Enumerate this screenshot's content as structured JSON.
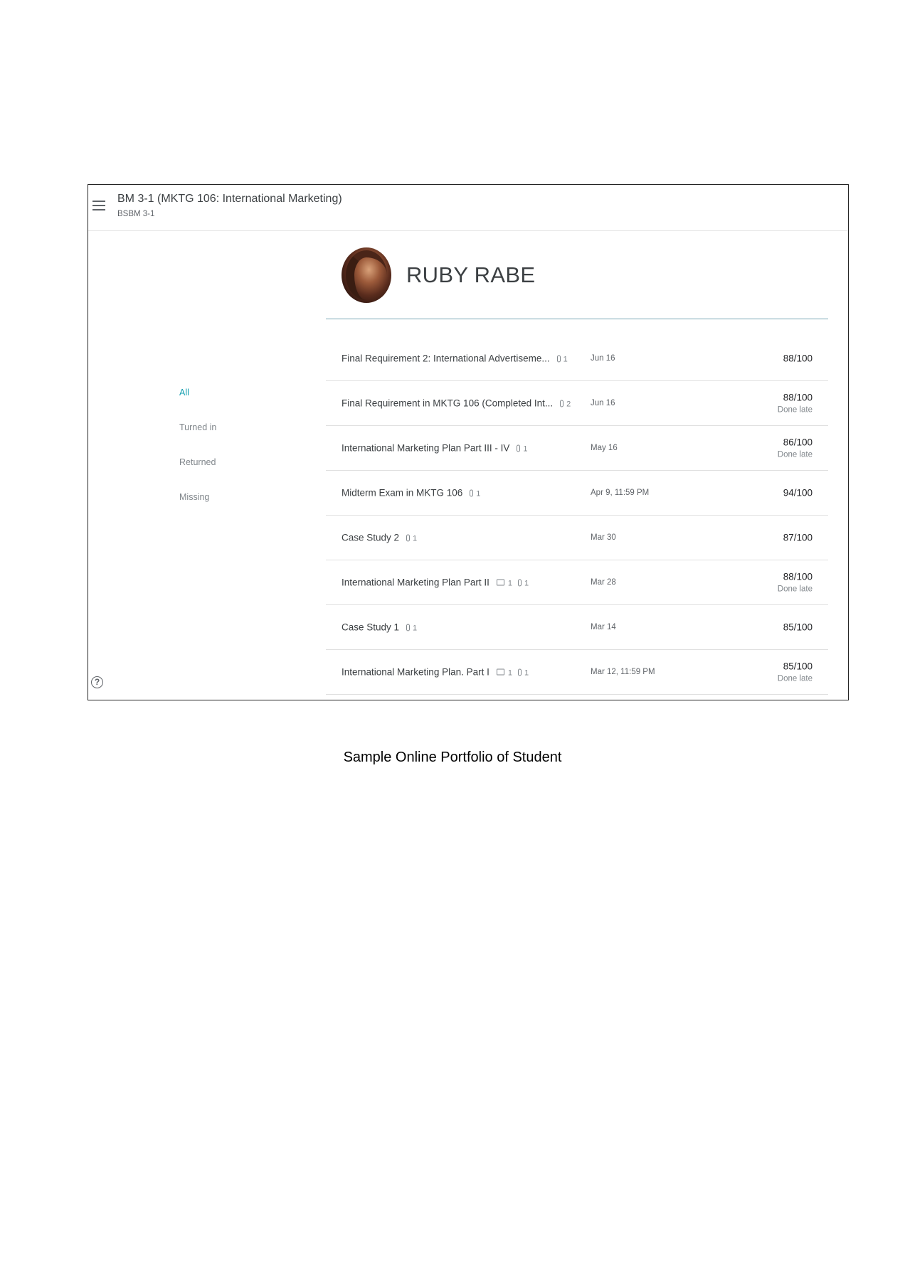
{
  "header": {
    "class_title": "BM 3-1 (MKTG 106: International Marketing)",
    "class_subtitle": "BSBM 3-1"
  },
  "student": {
    "name": "RUBY RABE"
  },
  "filters": [
    {
      "label": "All",
      "active": true
    },
    {
      "label": "Turned in",
      "active": false
    },
    {
      "label": "Returned",
      "active": false
    },
    {
      "label": "Missing",
      "active": false
    }
  ],
  "assignments": [
    {
      "title": "Final Requirement 2: International Advertiseme...",
      "attachments": "1",
      "comments": "",
      "due": "Jun 16",
      "score": "88/100",
      "status": ""
    },
    {
      "title": "Final Requirement in MKTG 106 (Completed Int...",
      "attachments": "2",
      "comments": "",
      "due": "Jun 16",
      "score": "88/100",
      "status": "Done late"
    },
    {
      "title": "International Marketing Plan Part III - IV",
      "attachments": "1",
      "comments": "",
      "due": "May 16",
      "score": "86/100",
      "status": "Done late"
    },
    {
      "title": "Midterm Exam in MKTG 106",
      "attachments": "1",
      "comments": "",
      "due": "Apr 9, 11:59 PM",
      "score": "94/100",
      "status": ""
    },
    {
      "title": "Case Study 2",
      "attachments": "1",
      "comments": "",
      "due": "Mar 30",
      "score": "87/100",
      "status": ""
    },
    {
      "title": "International Marketing Plan Part II",
      "attachments": "1",
      "comments": "1",
      "due": "Mar 28",
      "score": "88/100",
      "status": "Done late"
    },
    {
      "title": "Case Study 1",
      "attachments": "1",
      "comments": "",
      "due": "Mar 14",
      "score": "85/100",
      "status": ""
    },
    {
      "title": "International Marketing Plan. Part I",
      "attachments": "1",
      "comments": "1",
      "due": "Mar 12, 11:59 PM",
      "score": "85/100",
      "status": "Done late"
    }
  ],
  "caption": "Sample Online Portfolio of Student",
  "colors": {
    "accent": "#129eaf",
    "divider": "#7aa7b6"
  },
  "icons": {
    "menu": "hamburger-menu-icon",
    "help": "help-circle-icon",
    "attachment": "paperclip-icon",
    "comment": "comment-icon"
  }
}
